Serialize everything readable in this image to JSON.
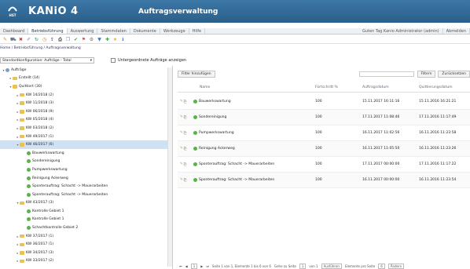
{
  "app": {
    "logo_text": "HST",
    "name": "KANiO 4",
    "module": "Auftragsverwaltung"
  },
  "menu": {
    "items": [
      "Dashboard",
      "Betriebsführung",
      "Auswertung",
      "Stammdaten",
      "Dokumente",
      "Werkzeuge",
      "Hilfe"
    ],
    "active": 1,
    "user": "Guten Tag Kanio Administrator (admin)",
    "logout": "Abmelden"
  },
  "breadcrumb": "Home / Betriebsführung / Auftragsverwaltung",
  "config": {
    "label": "Standardkonfiguration: Aufträge - Total",
    "checkbox": "Untergeordnete Aufträge anzeigen"
  },
  "tree": [
    {
      "label": "Aufträge",
      "lvl": 0,
      "icon": "globe",
      "open": true
    },
    {
      "label": "Erstellt (14)",
      "lvl": 1,
      "icon": "folder"
    },
    {
      "label": "Quittiert (30)",
      "lvl": 1,
      "icon": "folder",
      "open": true
    },
    {
      "label": "KW 14/2018 (2)",
      "lvl": 2,
      "icon": "folder"
    },
    {
      "label": "KW 11/2018 (3)",
      "lvl": 2,
      "icon": "folder"
    },
    {
      "label": "KW 06/2018 (9)",
      "lvl": 2,
      "icon": "folder"
    },
    {
      "label": "KW 05/2018 (4)",
      "lvl": 2,
      "icon": "folder"
    },
    {
      "label": "KW 03/2018 (2)",
      "lvl": 2,
      "icon": "folder"
    },
    {
      "label": "KW 49/2017 (1)",
      "lvl": 2,
      "icon": "folder"
    },
    {
      "label": "KW 46/2017 (6)",
      "lvl": 2,
      "icon": "folder",
      "open": true,
      "selected": true
    },
    {
      "label": "Bauwerkswartung",
      "lvl": 3,
      "icon": "ball"
    },
    {
      "label": "Sondereinigung",
      "lvl": 3,
      "icon": "ball"
    },
    {
      "label": "Pumpwerkswartung",
      "lvl": 3,
      "icon": "ball"
    },
    {
      "label": "Reinigung Ackerweg",
      "lvl": 3,
      "icon": "ball"
    },
    {
      "label": "Sponterauftrag: Schacht -> Mauerarbeiten",
      "lvl": 3,
      "icon": "ball"
    },
    {
      "label": "Sponterauftrag: Schacht -> Mauerarbeiten",
      "lvl": 3,
      "icon": "ball"
    },
    {
      "label": "KW 43/2017 (3)",
      "lvl": 2,
      "icon": "folder",
      "open": true
    },
    {
      "label": "Kontrolle Gebiet 1",
      "lvl": 3,
      "icon": "ball"
    },
    {
      "label": "Kontrolle Gebiet 1",
      "lvl": 3,
      "icon": "ball"
    },
    {
      "label": "Schachtkontrolle Gebiet 2",
      "lvl": 3,
      "icon": "ball"
    },
    {
      "label": "KW 37/2017 (1)",
      "lvl": 2,
      "icon": "folder"
    },
    {
      "label": "KW 36/2017 (1)",
      "lvl": 2,
      "icon": "folder"
    },
    {
      "label": "KW 34/2017 (3)",
      "lvl": 2,
      "icon": "folder"
    },
    {
      "label": "KW 33/2017 (2)",
      "lvl": 2,
      "icon": "folder"
    }
  ],
  "grid": {
    "add_filter": "Filter hinzufügen",
    "filter_btn": "Filtern",
    "reset_btn": "Zurücksetzen",
    "columns": [
      "Name",
      "Fortschritt %",
      "Auftragsdatum",
      "Quittierungsdatum"
    ],
    "rows": [
      [
        "Bauwerkswartung",
        "100",
        "15.11.2017 16:11:16",
        "15.11.2016 16:21:21"
      ],
      [
        "Sondereinigung",
        "100",
        "17.11.2017 11:08:46",
        "17.11.2016 11:17:49"
      ],
      [
        "Pumpwerkswartung",
        "100",
        "16.11.2017 11:02:56",
        "16.11.2016 11:23:58"
      ],
      [
        "Reinigung Ackerweg",
        "100",
        "16.11.2017 11:05:50",
        "16.11.2016 11:23:26"
      ],
      [
        "Sponterauftrag: Schacht -> Mauerarbeiten",
        "100",
        "17.11.2017 00:00:00",
        "17.11.2016 11:17:22"
      ],
      [
        "Sponterauftrag: Schacht -> Mauerarbeiten",
        "100",
        "16.11.2017 00:00:00",
        "16.11.2016 11:23:54"
      ]
    ]
  },
  "pager": {
    "info": "Seite 1 von 1, Elemente 1 bis 6 von 6",
    "goto": "Gehe zu Seite",
    "page": "1",
    "of": "von 1",
    "execute": "Ausführen",
    "per_page": "Elemente pro Seite",
    "size": "6",
    "change": "Ändern"
  }
}
